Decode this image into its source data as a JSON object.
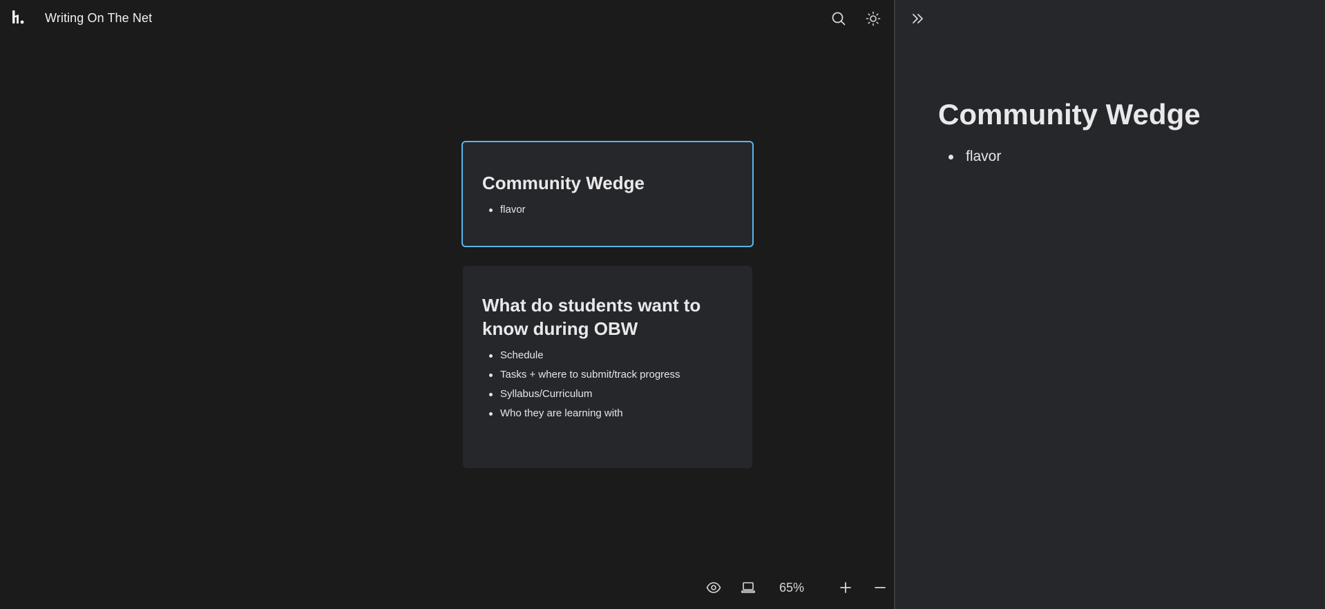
{
  "app": {
    "title": "Writing On The Net"
  },
  "toolbar": {
    "search_icon": "search-icon",
    "theme_icon": "sun-icon"
  },
  "cards": [
    {
      "title": "Community Wedge",
      "items": [
        "flavor"
      ],
      "selected": true
    },
    {
      "title": "What do students want to know during OBW",
      "items": [
        "Schedule",
        "Tasks + where to submit/track progress",
        "Syllabus/Curriculum",
        "Who they are learning with"
      ],
      "selected": false
    }
  ],
  "bottom_bar": {
    "zoom_level": "65%",
    "preview_icon": "eye-icon",
    "presentation_icon": "laptop-icon",
    "zoom_in_icon": "plus-icon",
    "zoom_out_icon": "minus-icon"
  },
  "panel": {
    "collapse_icon": "double-chevron-right-icon",
    "title": "Community Wedge",
    "items": [
      "flavor"
    ]
  },
  "colors": {
    "canvas_bg": "#1b1b1c",
    "card_bg": "#26272b",
    "selected_border": "#5bb6ea",
    "panel_bg": "#26272b"
  }
}
